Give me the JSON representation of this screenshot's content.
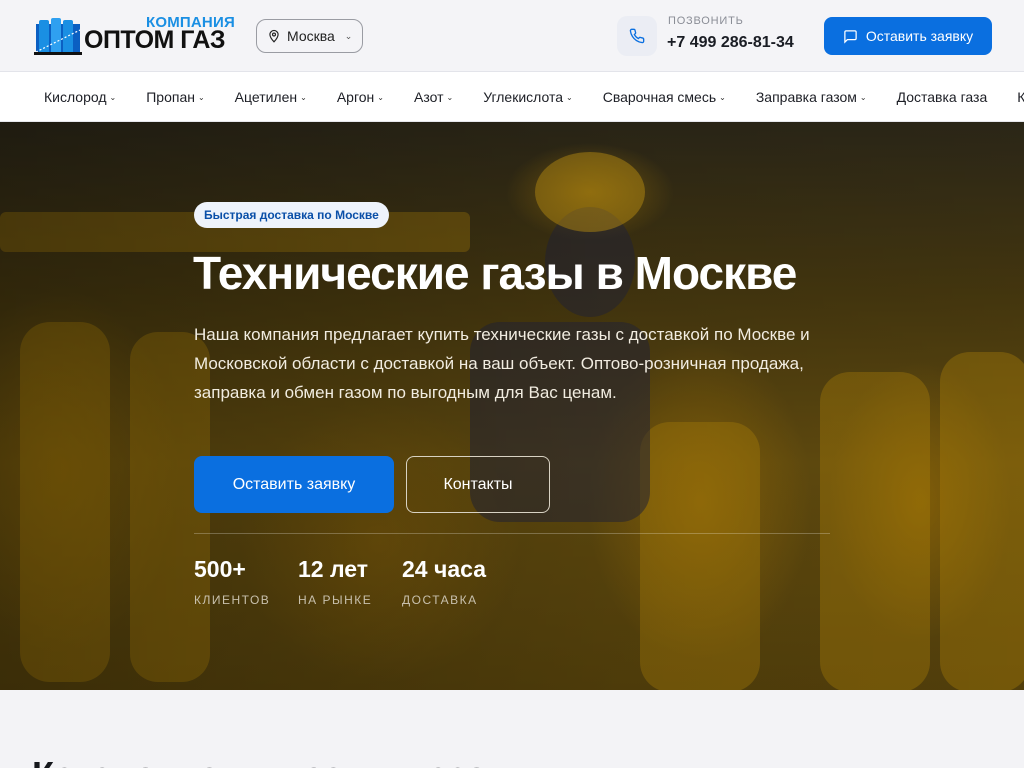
{
  "header": {
    "logo_top": "КОМПАНИЯ",
    "logo_main": "ОПТОМ ГАЗ",
    "city": "Москва",
    "call_label": "ПОЗВОНИТЬ",
    "phone": "+7 499 286-81-34",
    "cta_label": "Оставить заявку"
  },
  "nav": {
    "items": [
      {
        "label": "Кислород",
        "dropdown": true
      },
      {
        "label": "Пропан",
        "dropdown": true
      },
      {
        "label": "Ацетилен",
        "dropdown": true
      },
      {
        "label": "Аргон",
        "dropdown": true
      },
      {
        "label": "Азот",
        "dropdown": true
      },
      {
        "label": "Углекислота",
        "dropdown": true
      },
      {
        "label": "Сварочная смесь",
        "dropdown": true
      },
      {
        "label": "Заправка газом",
        "dropdown": true
      },
      {
        "label": "Доставка газа",
        "dropdown": false
      },
      {
        "label": "Ко",
        "dropdown": false
      }
    ]
  },
  "hero": {
    "badge": "Быстрая доставка по Москве",
    "title": "Технические газы в Москве",
    "text": "Наша компания предлагает купить технические газы с доставкой по Москве и Московской области с доставкой на ваш объект. Оптово-розничная продажа, заправка и обмен газом по выгодным для Вас ценам.",
    "primary_button": "Оставить заявку",
    "secondary_button": "Контакты",
    "stats": [
      {
        "value": "500+",
        "label": "КЛИЕНТОВ"
      },
      {
        "value": "12 лет",
        "label": "НА РЫНКЕ"
      },
      {
        "value": "24 часа",
        "label": "ДОСТАВКА"
      }
    ]
  },
  "catalog": {
    "title": "Каталог технических газов"
  },
  "colors": {
    "accent": "#0a6fe0",
    "logo_blue": "#1a8fe3",
    "badge_text": "#0a4fa8"
  },
  "icons": {
    "city": "map-pin-icon",
    "phone": "phone-icon",
    "cta": "chat-icon",
    "dropdown": "chevron-down-icon"
  }
}
